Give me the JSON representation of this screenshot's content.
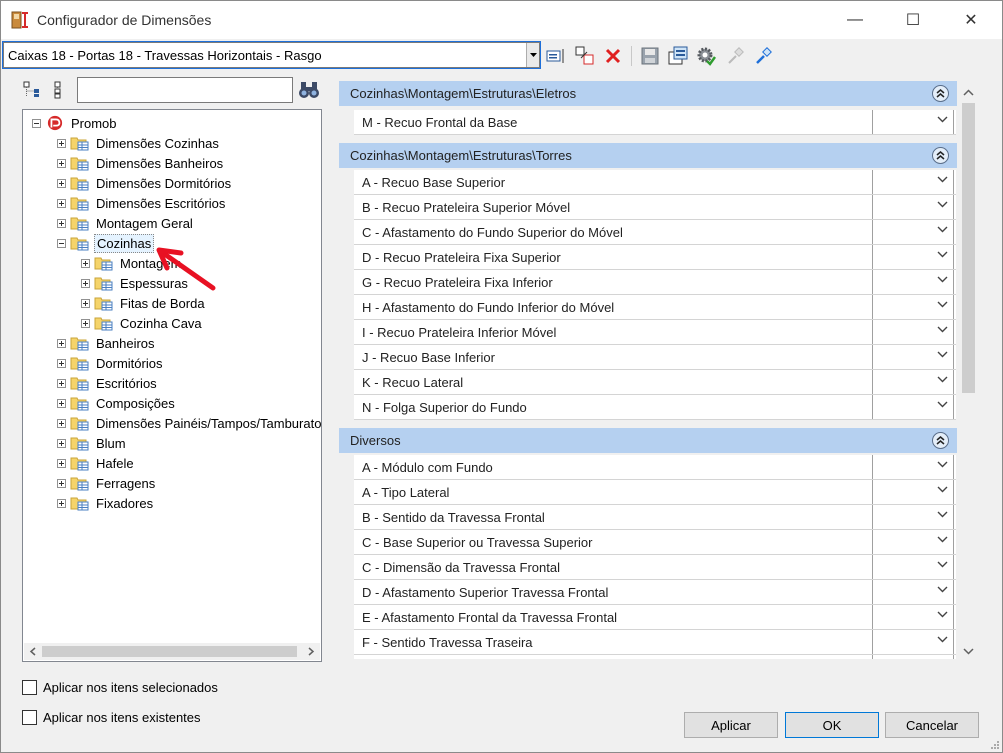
{
  "window": {
    "title": "Configurador de Dimensões",
    "minimize": "—",
    "maximize": "☐",
    "close": "✕"
  },
  "toolbar": {
    "profile_value": "Caixas 18 - Portas 18 - Travessas Horizontais - Rasgo",
    "icons": [
      "edit-icon",
      "copy-icon",
      "delete-icon",
      "save-icon",
      "export-icon",
      "settings-icon",
      "pin-disabled-icon",
      "pin-icon"
    ]
  },
  "tree_panel": {
    "search_value": "",
    "items": [
      {
        "label": "Promob",
        "level": 0,
        "expanded": true
      },
      {
        "label": "Dimensões Cozinhas",
        "level": 1
      },
      {
        "label": "Dimensões Banheiros",
        "level": 1
      },
      {
        "label": "Dimensões Dormitórios",
        "level": 1
      },
      {
        "label": "Dimensões Escritórios",
        "level": 1
      },
      {
        "label": "Montagem Geral",
        "level": 1
      },
      {
        "label": "Cozinhas",
        "level": 1,
        "expanded": true,
        "selected": true
      },
      {
        "label": "Montagem",
        "level": 2
      },
      {
        "label": "Espessuras",
        "level": 2
      },
      {
        "label": "Fitas de Borda",
        "level": 2
      },
      {
        "label": "Cozinha Cava",
        "level": 2
      },
      {
        "label": "Banheiros",
        "level": 1
      },
      {
        "label": "Dormitórios",
        "level": 1
      },
      {
        "label": "Escritórios",
        "level": 1
      },
      {
        "label": "Composições",
        "level": 1
      },
      {
        "label": "Dimensões Painéis/Tampos/Tamburatos",
        "level": 1
      },
      {
        "label": "Blum",
        "level": 1
      },
      {
        "label": "Hafele",
        "level": 1
      },
      {
        "label": "Ferragens",
        "level": 1
      },
      {
        "label": "Fixadores",
        "level": 1
      }
    ]
  },
  "properties": {
    "sections": [
      {
        "title": "Cozinhas\\Montagem\\Estruturas\\Eletros",
        "rows": [
          "M - Recuo Frontal da Base"
        ]
      },
      {
        "title": "Cozinhas\\Montagem\\Estruturas\\Torres",
        "rows": [
          "A - Recuo Base Superior",
          "B - Recuo Prateleira Superior Móvel",
          "C - Afastamento do Fundo Superior do Móvel",
          "D - Recuo Prateleira Fixa Superior",
          "G - Recuo Prateleira Fixa Inferior",
          "H - Afastamento do Fundo Inferior do Móvel",
          "I - Recuo Prateleira Inferior Móvel",
          "J - Recuo Base Inferior",
          "K - Recuo Lateral",
          "N - Folga Superior do Fundo"
        ]
      },
      {
        "title": "Diversos",
        "rows": [
          "A - Módulo com Fundo",
          "A - Tipo Lateral",
          "B - Sentido da Travessa Frontal",
          "C - Base Superior ou Travessa Superior",
          "C - Dimensão da Travessa Frontal",
          "D - Afastamento Superior Travessa Frontal",
          "E - Afastamento Frontal da Travessa Frontal",
          "F - Sentido Travessa Traseira",
          ""
        ]
      }
    ]
  },
  "options": {
    "apply_selected": "Aplicar nos itens selecionados",
    "apply_existing": "Aplicar nos itens existentes"
  },
  "buttons": {
    "apply": "Aplicar",
    "ok": "OK",
    "cancel": "Cancelar"
  },
  "colors": {
    "section_header": "#b5d0f0",
    "accent": "#0078d7",
    "annotation_arrow": "#e81123"
  }
}
